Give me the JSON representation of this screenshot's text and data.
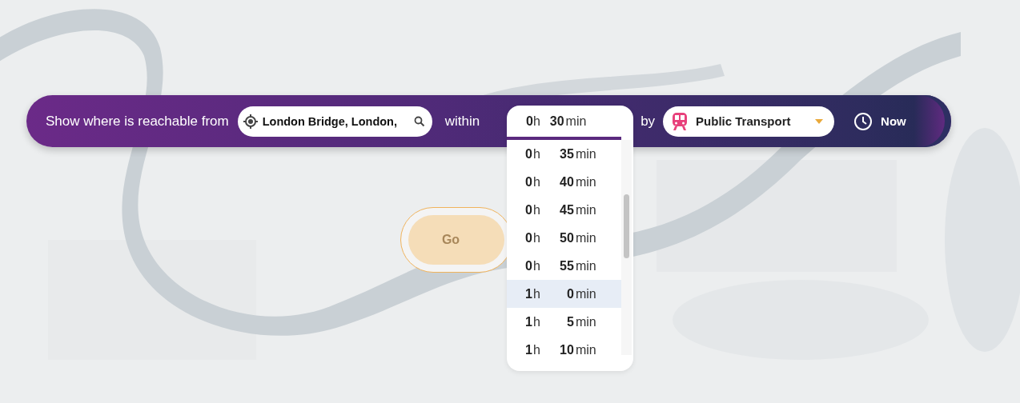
{
  "search_bar": {
    "label": "Show where is reachable from",
    "origin": {
      "value": "London Bridge, London,"
    },
    "within_label": "within",
    "duration": {
      "hours": "0",
      "hour_unit": "h",
      "minutes": "30",
      "minute_unit": "min",
      "expanded": true
    },
    "by_label": "by",
    "mode": {
      "value": "Public Transport"
    },
    "time": {
      "label": "Now"
    }
  },
  "duration_options": [
    {
      "hours": "0",
      "hour_unit": "h",
      "minutes": "35",
      "minute_unit": "min",
      "selected": false
    },
    {
      "hours": "0",
      "hour_unit": "h",
      "minutes": "40",
      "minute_unit": "min",
      "selected": false
    },
    {
      "hours": "0",
      "hour_unit": "h",
      "minutes": "45",
      "minute_unit": "min",
      "selected": false
    },
    {
      "hours": "0",
      "hour_unit": "h",
      "minutes": "50",
      "minute_unit": "min",
      "selected": false
    },
    {
      "hours": "0",
      "hour_unit": "h",
      "minutes": "55",
      "minute_unit": "min",
      "selected": false
    },
    {
      "hours": "1",
      "hour_unit": "h",
      "minutes": "0",
      "minute_unit": "min",
      "selected": true
    },
    {
      "hours": "1",
      "hour_unit": "h",
      "minutes": "5",
      "minute_unit": "min",
      "selected": false
    },
    {
      "hours": "1",
      "hour_unit": "h",
      "minutes": "10",
      "minute_unit": "min",
      "selected": false
    }
  ],
  "go_button": {
    "label": "Go"
  }
}
